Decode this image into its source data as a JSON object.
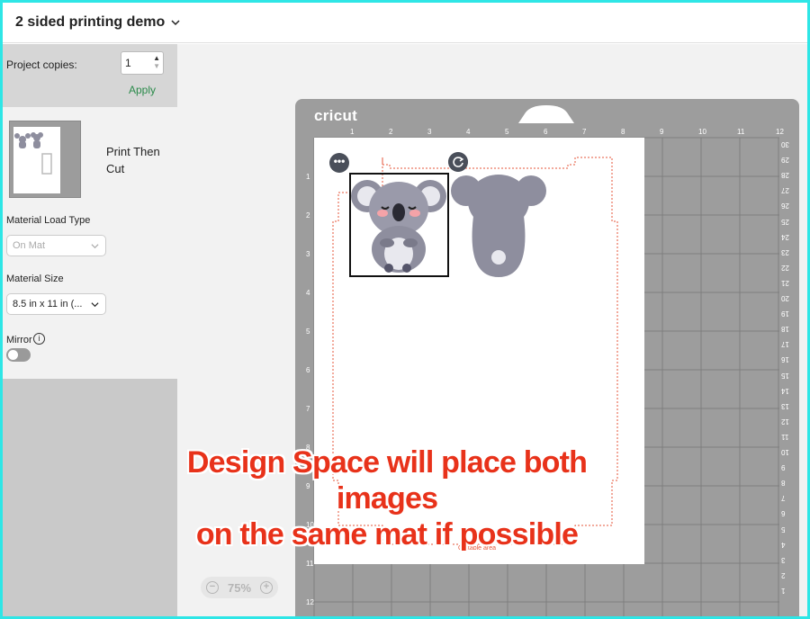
{
  "header": {
    "title": "2 sided printing demo",
    "dropdown_icon": "chevron-down-icon"
  },
  "left_panel": {
    "copies_label": "Project copies:",
    "copies_value": "1",
    "apply_label": "Apply",
    "mat_mode": "Print Then Cut",
    "material_load_type_label": "Material Load Type",
    "material_load_type_value": "On Mat",
    "material_size_label": "Material Size",
    "material_size_value": "8.5 in x 11 in (...",
    "mirror_label": "Mirror",
    "mirror_on": false,
    "info_glyph": "i"
  },
  "mat": {
    "brand": "cricut",
    "top_ruler": [
      "1",
      "2",
      "3",
      "4",
      "5",
      "6",
      "7",
      "8",
      "9",
      "10",
      "11",
      "12"
    ],
    "left_ruler": [
      "1",
      "2",
      "3",
      "4",
      "5",
      "6",
      "7",
      "8",
      "9",
      "10",
      "11",
      "12"
    ],
    "right_ruler": [
      "30",
      "29",
      "28",
      "27",
      "26",
      "25",
      "24",
      "23",
      "22",
      "21",
      "20",
      "19",
      "18",
      "17",
      "16",
      "15",
      "14",
      "13",
      "12",
      "11",
      "10",
      "9",
      "8",
      "7",
      "6",
      "5",
      "4",
      "3",
      "2",
      "1"
    ],
    "cuttable_label": "Cuttable area",
    "more_glyph": "•••"
  },
  "zoom": {
    "value": "75%",
    "minus": "−",
    "plus": "+"
  },
  "caption": {
    "line1": "Design Space will place both images",
    "line2": "on the same mat if possible"
  },
  "colors": {
    "accent_frame": "#2ee6e6",
    "caption": "#e8321a",
    "apply": "#2a8a4a",
    "koala_body": "#8e8e9e"
  }
}
